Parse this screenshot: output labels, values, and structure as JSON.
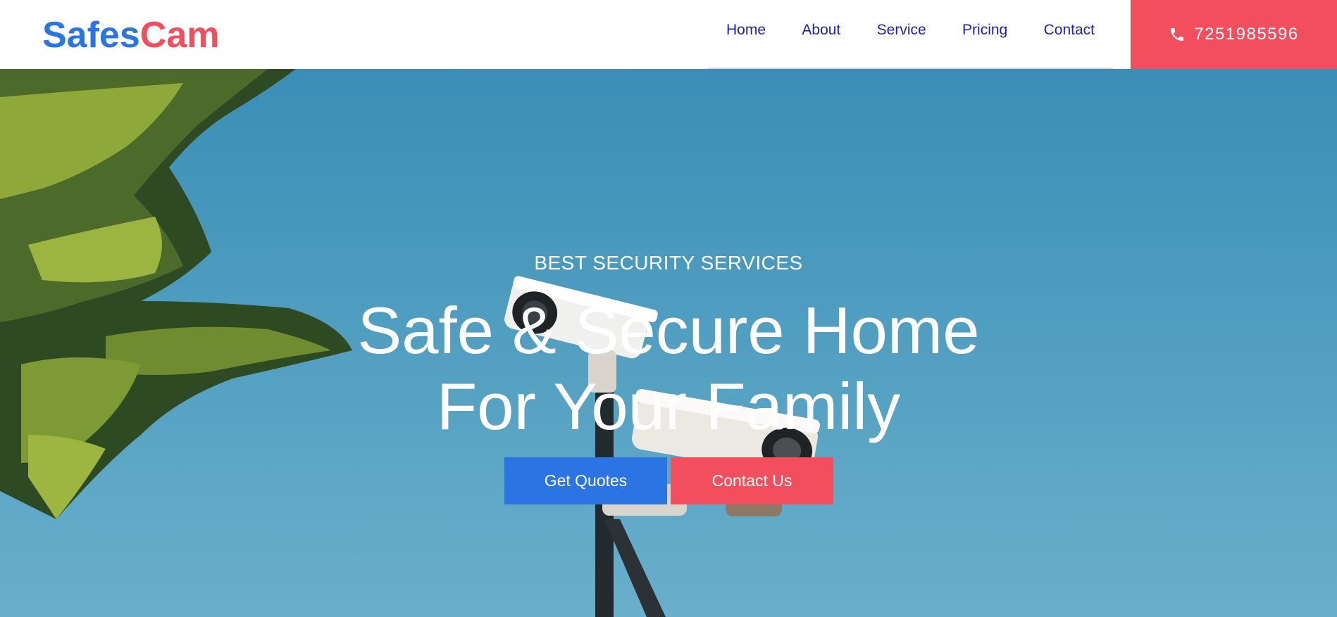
{
  "brand": {
    "part1": "Safes",
    "part2": "Cam"
  },
  "nav": {
    "items": [
      {
        "label": "Home"
      },
      {
        "label": "About"
      },
      {
        "label": "Service"
      },
      {
        "label": "Pricing"
      },
      {
        "label": "Contact"
      }
    ]
  },
  "phone": {
    "icon": "phone-icon",
    "number": "7251985596"
  },
  "hero": {
    "eyebrow": "BEST SECURITY SERVICES",
    "headline_line1": "Safe & Secure Home",
    "headline_line2": "For Your Family",
    "primary_button": "Get Quotes",
    "secondary_button": "Contact Us"
  },
  "colors": {
    "brand_blue": "#2b74e4",
    "brand_red": "#f24e5e",
    "nav_link": "#1a1fb8",
    "sky": "#4a9cc0"
  }
}
